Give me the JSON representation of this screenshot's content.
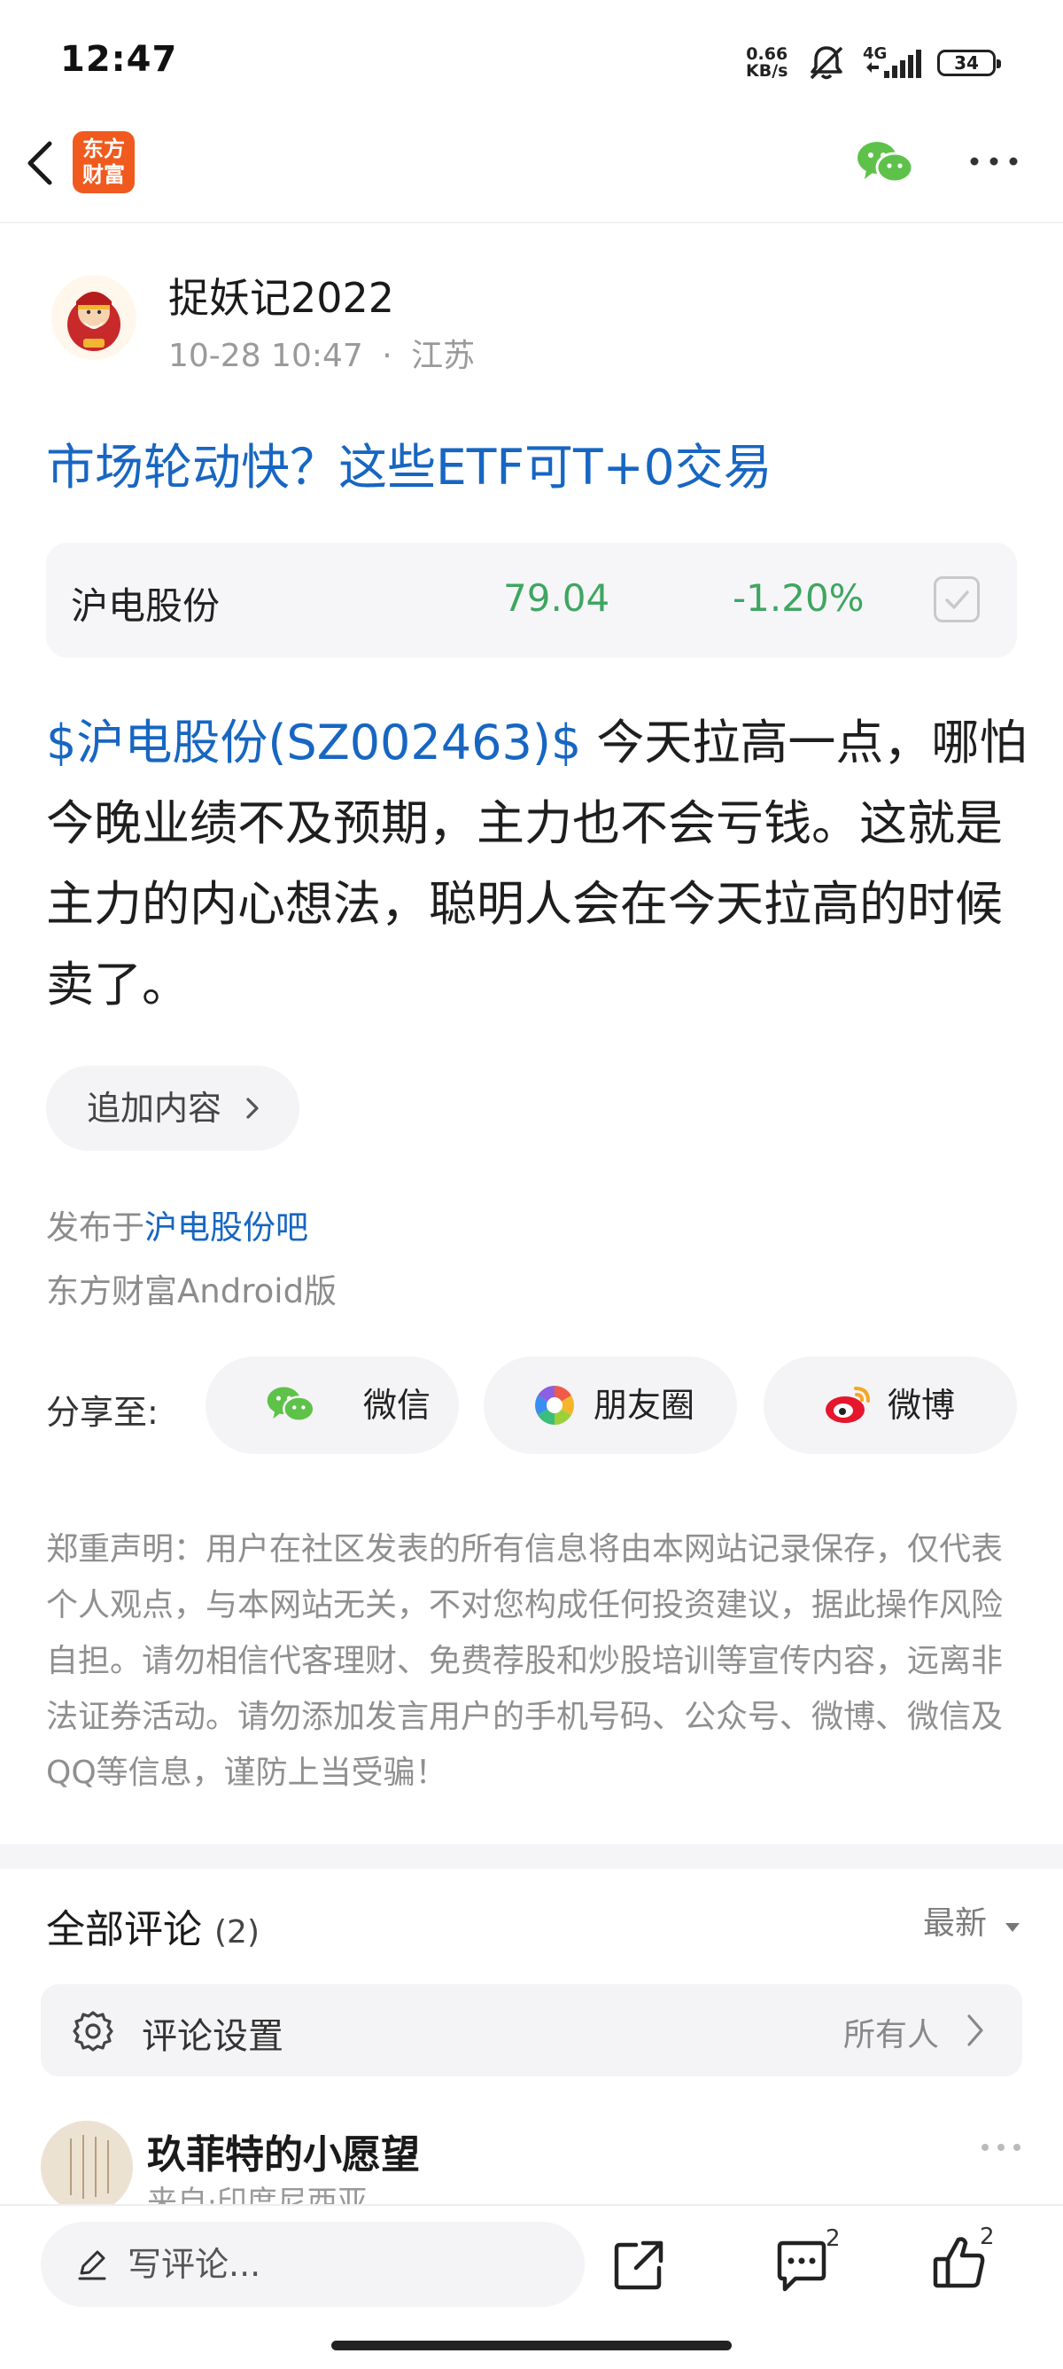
{
  "status_bar": {
    "time": "12:47",
    "net_speed_value": "0.66",
    "net_speed_unit": "KB/s",
    "signal_type": "4G",
    "battery": "34"
  },
  "header": {
    "back_icon": "chevron-left-icon",
    "app_logo_line1": "东方",
    "app_logo_line2": "财富",
    "wechat_icon": "wechat-icon",
    "more_icon": "more-horizontal-icon"
  },
  "post": {
    "author": "捉妖记2022",
    "date": "10-28 10:47",
    "separator": "·",
    "location": "江苏",
    "title": "市场轮动快？这些ETF可T+0交易",
    "stock": {
      "name": "沪电股份",
      "price": "79.04",
      "change": "-1.20%",
      "change_color": "#3ea661"
    },
    "body_tag": "$沪电股份(SZ002463)$",
    "body_text": " 今天拉高一点，哪怕今晚业绩不及预期，主力也不会亏钱。这就是主力的内心想法，聪明人会在今天拉高的时候卖了。",
    "add_content_label": "追加内容",
    "published_prefix": "发布于",
    "published_bar": "沪电股份吧",
    "client": "东方财富Android版"
  },
  "share": {
    "label": "分享至:",
    "options": [
      {
        "label": "微信",
        "icon": "wechat-icon"
      },
      {
        "label": "朋友圈",
        "icon": "moments-icon"
      },
      {
        "label": "微博",
        "icon": "weibo-icon"
      }
    ]
  },
  "disclaimer": "郑重声明：用户在社区发表的所有信息将由本网站记录保存，仅代表个人观点，与本网站无关，不对您构成任何投资建议，据此操作风险自担。请勿相信代客理财、免费荐股和炒股培训等宣传内容，远离非法证券活动。请勿添加发言用户的手机号码、公众号、微博、微信及QQ等信息，谨防上当受骗！",
  "comments": {
    "title": "全部评论",
    "count": "(2)",
    "sort_label": "最新",
    "settings_label": "评论设置",
    "settings_value": "所有人",
    "items": [
      {
        "name": "玖菲特的小愿望",
        "from": "来自·印度尼西亚"
      }
    ]
  },
  "bottom_bar": {
    "comment_placeholder": "写评论...",
    "share_count": "",
    "comment_count": "2",
    "like_count": "2"
  },
  "colors": {
    "link_blue": "#1766c2",
    "stock_green": "#3ea661",
    "brand_orange": "#f05a1e",
    "wechat_green": "#5ec24a",
    "weibo_red": "#e6162d"
  }
}
